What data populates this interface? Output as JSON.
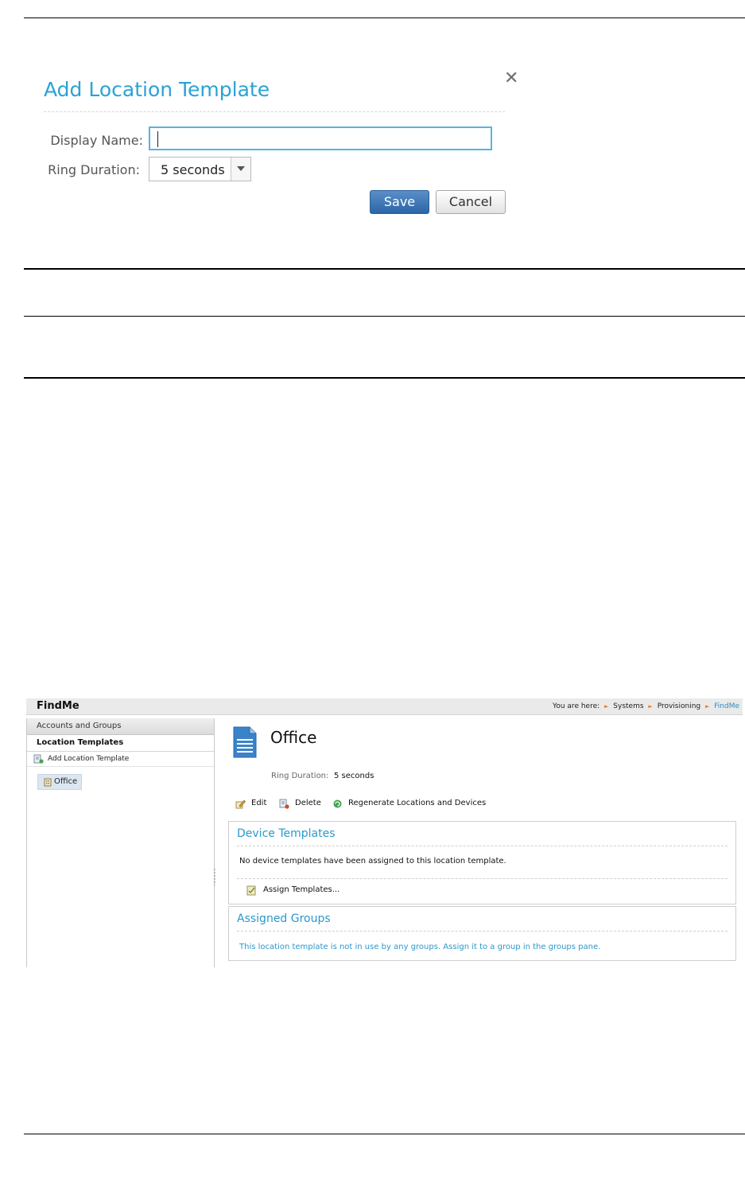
{
  "dialog": {
    "title": "Add Location Template",
    "close_label": "✕",
    "display_name_label": "Display Name:",
    "display_name_value": "",
    "ring_duration_label": "Ring Duration:",
    "ring_duration_value": "5 seconds",
    "save_label": "Save",
    "cancel_label": "Cancel"
  },
  "app": {
    "title": "FindMe",
    "breadcrumb": {
      "prefix": "You are here:",
      "items": [
        "Systems",
        "Provisioning",
        "FindMe"
      ]
    },
    "sidebar": {
      "accounts_label": "Accounts and Groups",
      "location_templates_label": "Location Templates",
      "add_label": "Add Location Template",
      "office_label": "Office"
    },
    "main": {
      "title": "Office",
      "ring_duration_label": "Ring Duration:",
      "ring_duration_value": "5 seconds",
      "toolbar": {
        "edit_label": "Edit",
        "delete_label": "Delete",
        "regenerate_label": "Regenerate Locations and Devices"
      },
      "device_templates": {
        "title": "Device Templates",
        "message": "No device templates have been assigned to this location template.",
        "assign_label": "Assign Templates..."
      },
      "assigned_groups": {
        "title": "Assigned Groups",
        "message": "This location template is not in use by any groups. Assign it to a group in the groups pane."
      }
    }
  },
  "colors": {
    "accent_blue": "#29a3d4",
    "save_button": "#2c66a8",
    "breadcrumb_arrow": "#e0771f"
  }
}
